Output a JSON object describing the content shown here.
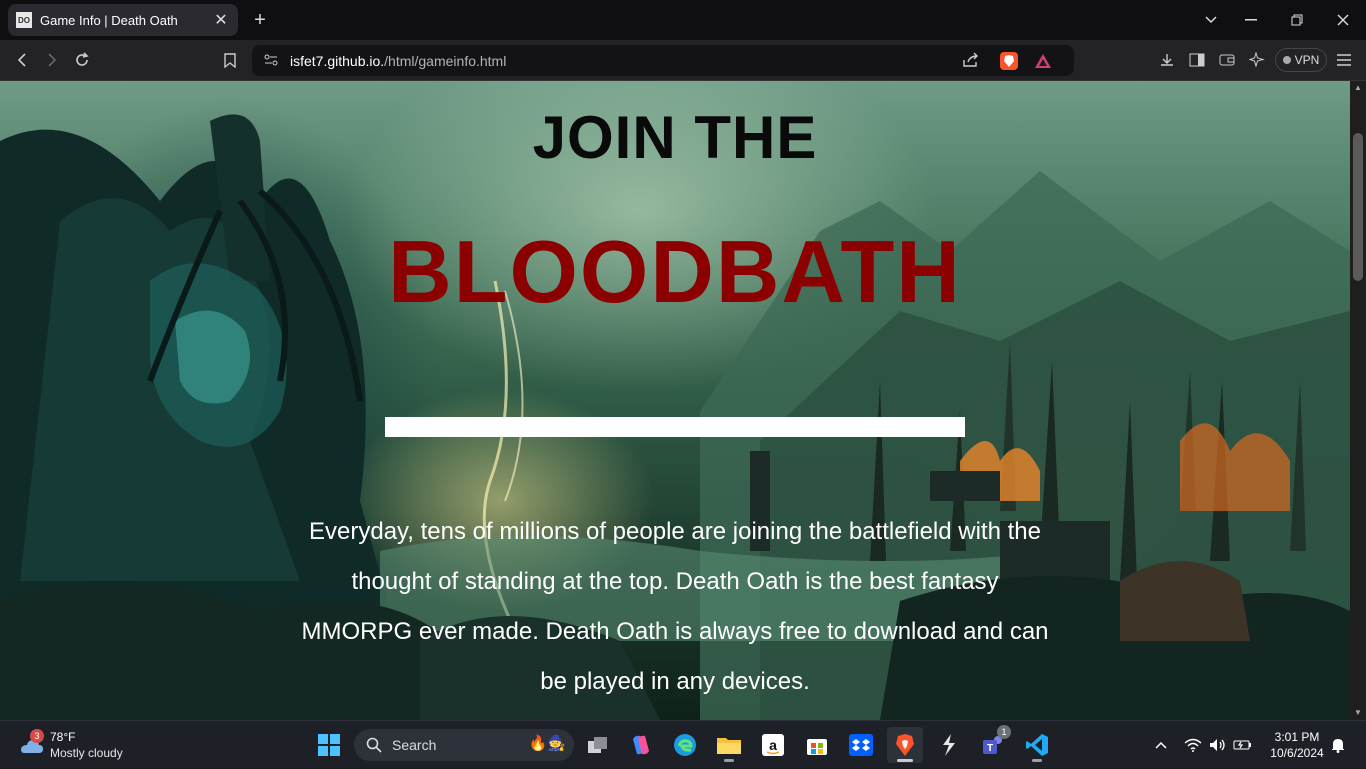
{
  "browser": {
    "tab": {
      "favicon_text": "DO",
      "title": "Game Info | Death Oath"
    },
    "address": {
      "host": "isfet7.github.io.",
      "path": "/html/gameinfo.html"
    },
    "vpn_label": "VPN"
  },
  "page": {
    "headline_top": "JOIN THE",
    "headline_main": "BLOODBATH",
    "intro_text": "Everyday, tens of millions of people are joining the battlefield with the thought of standing at the top. Death Oath is the best fantasy MMORPG ever made. Death Oath is always free to download and can be played in any devices.",
    "colors": {
      "headline_main": "#8b0000",
      "headline_top": "#0a0a0a",
      "intro": "#ffffff"
    }
  },
  "taskbar": {
    "weather": {
      "badge": "3",
      "temperature": "78°F",
      "condition": "Mostly cloudy"
    },
    "search_label": "Search",
    "teams_badge": "1",
    "clock": {
      "time": "3:01 PM",
      "date": "10/6/2024"
    }
  }
}
